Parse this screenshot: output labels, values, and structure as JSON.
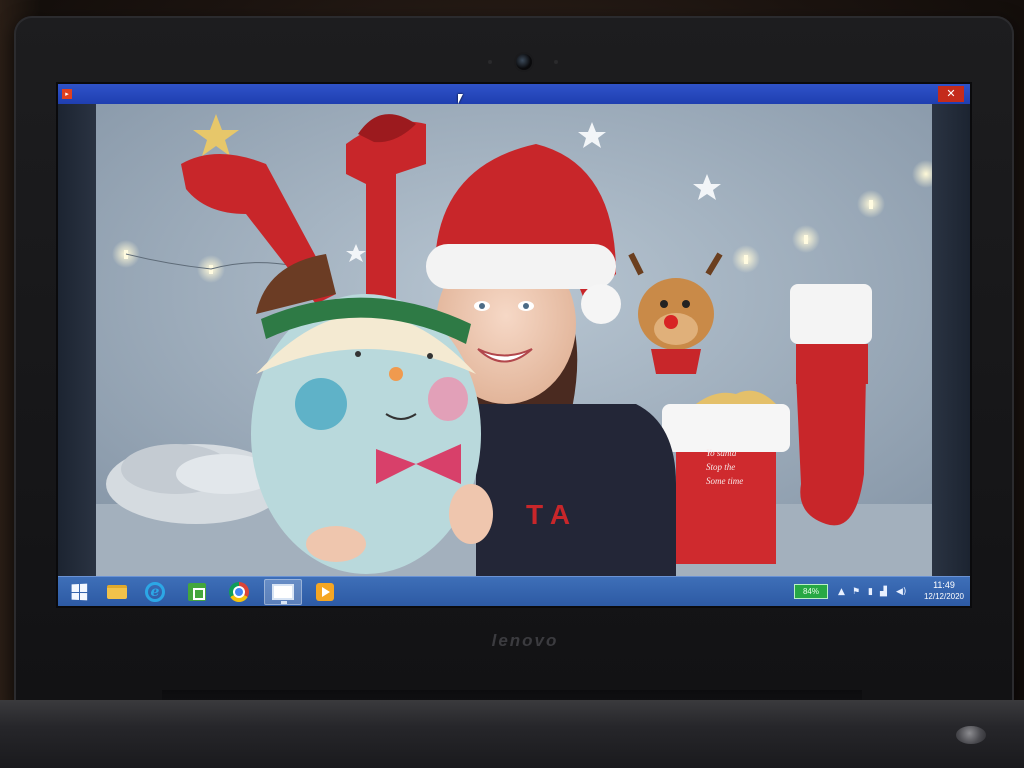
{
  "device": {
    "brand": "lenovo"
  },
  "window": {
    "close_glyph": "✕",
    "app_icon_glyph": "▸"
  },
  "taskbar": {
    "apps": [
      {
        "name": "start",
        "icon": "windows-logo-icon"
      },
      {
        "name": "file-explorer",
        "icon": "folder-icon"
      },
      {
        "name": "internet-explorer",
        "icon": "internet-explorer-icon"
      },
      {
        "name": "store",
        "icon": "store-icon"
      },
      {
        "name": "chrome",
        "icon": "chrome-icon"
      },
      {
        "name": "remote-desktop",
        "icon": "monitor-icon",
        "active": true
      },
      {
        "name": "media-player",
        "icon": "media-player-icon"
      }
    ],
    "battery_percent": "84%",
    "tray_icons": [
      "▲",
      "⚑",
      "▮",
      "▟",
      "◀)"
    ],
    "time": "11:49",
    "date": "12/12/2020"
  },
  "video": {
    "stocking_text": [
      "Yo santa",
      "Stop the",
      "Some time"
    ],
    "tshirt_letters": "T A"
  },
  "colors": {
    "titlebar": "#1f3fb0",
    "taskbar": "#2d5aa4",
    "close": "#c42b1c",
    "battery": "#27a844"
  }
}
